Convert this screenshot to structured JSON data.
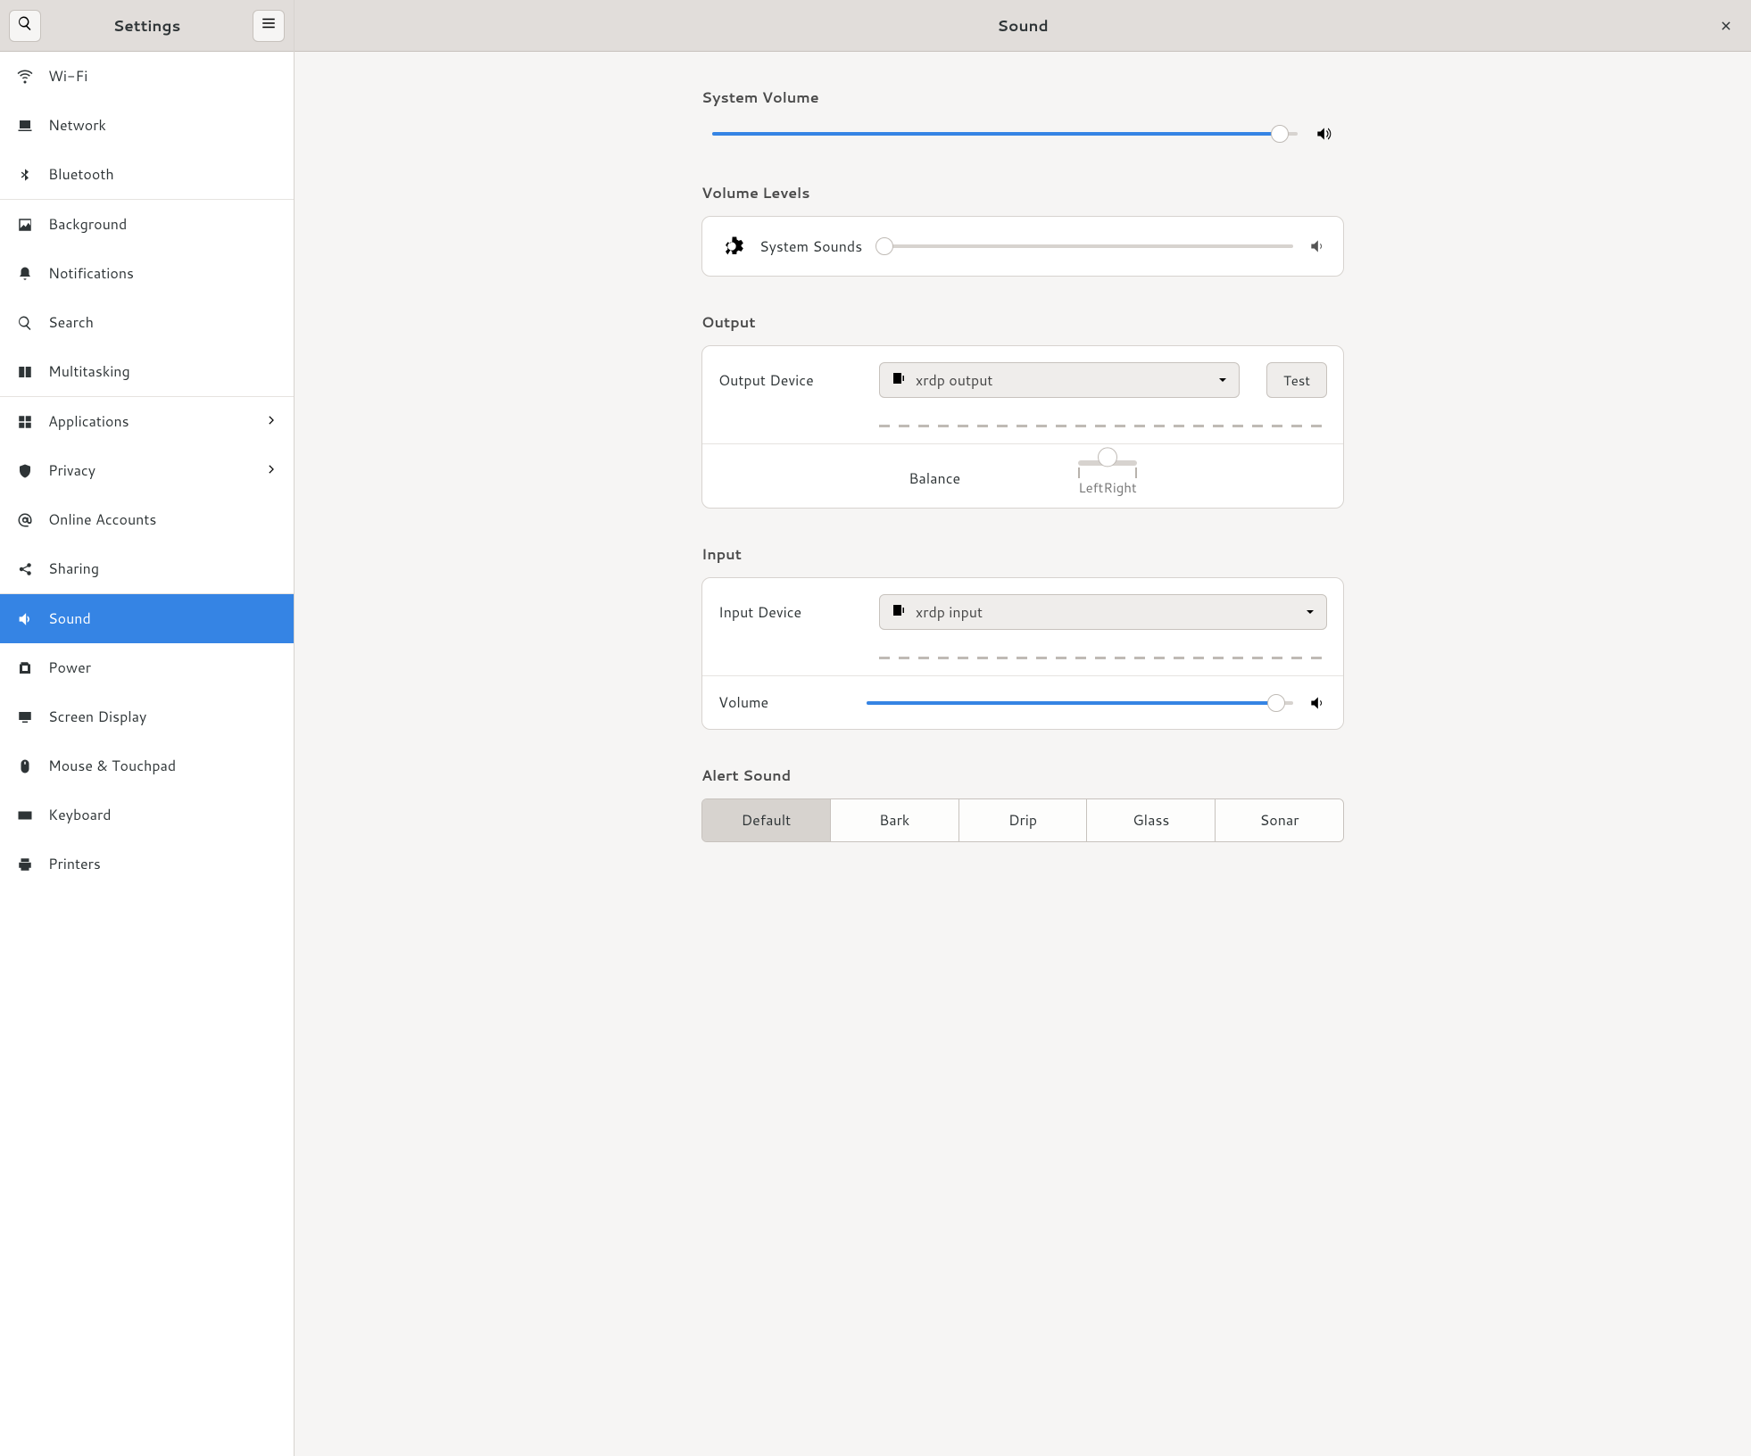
{
  "sidebar": {
    "title": "Settings",
    "items": [
      {
        "label": "Wi-Fi"
      },
      {
        "label": "Network"
      },
      {
        "label": "Bluetooth"
      },
      {
        "label": "Background"
      },
      {
        "label": "Notifications"
      },
      {
        "label": "Search"
      },
      {
        "label": "Multitasking"
      },
      {
        "label": "Applications"
      },
      {
        "label": "Privacy"
      },
      {
        "label": "Online Accounts"
      },
      {
        "label": "Sharing"
      },
      {
        "label": "Sound"
      },
      {
        "label": "Power"
      },
      {
        "label": "Screen Display"
      },
      {
        "label": "Mouse & Touchpad"
      },
      {
        "label": "Keyboard"
      },
      {
        "label": "Printers"
      }
    ]
  },
  "header": {
    "title": "Sound"
  },
  "system_volume": {
    "heading": "System Volume",
    "value_percent": 97
  },
  "volume_levels": {
    "heading": "Volume Levels",
    "system_sounds_label": "System Sounds",
    "system_sounds_percent": 2
  },
  "output": {
    "heading": "Output",
    "device_label": "Output Device",
    "device_value": "xrdp output",
    "test_label": "Test",
    "balance_label": "Balance",
    "balance_left": "Left",
    "balance_right": "Right",
    "balance_percent": 50
  },
  "input": {
    "heading": "Input",
    "device_label": "Input Device",
    "device_value": "xrdp input",
    "volume_label": "Volume",
    "volume_percent": 96
  },
  "alert": {
    "heading": "Alert Sound",
    "options": [
      "Default",
      "Bark",
      "Drip",
      "Glass",
      "Sonar"
    ],
    "selected": "Default"
  }
}
